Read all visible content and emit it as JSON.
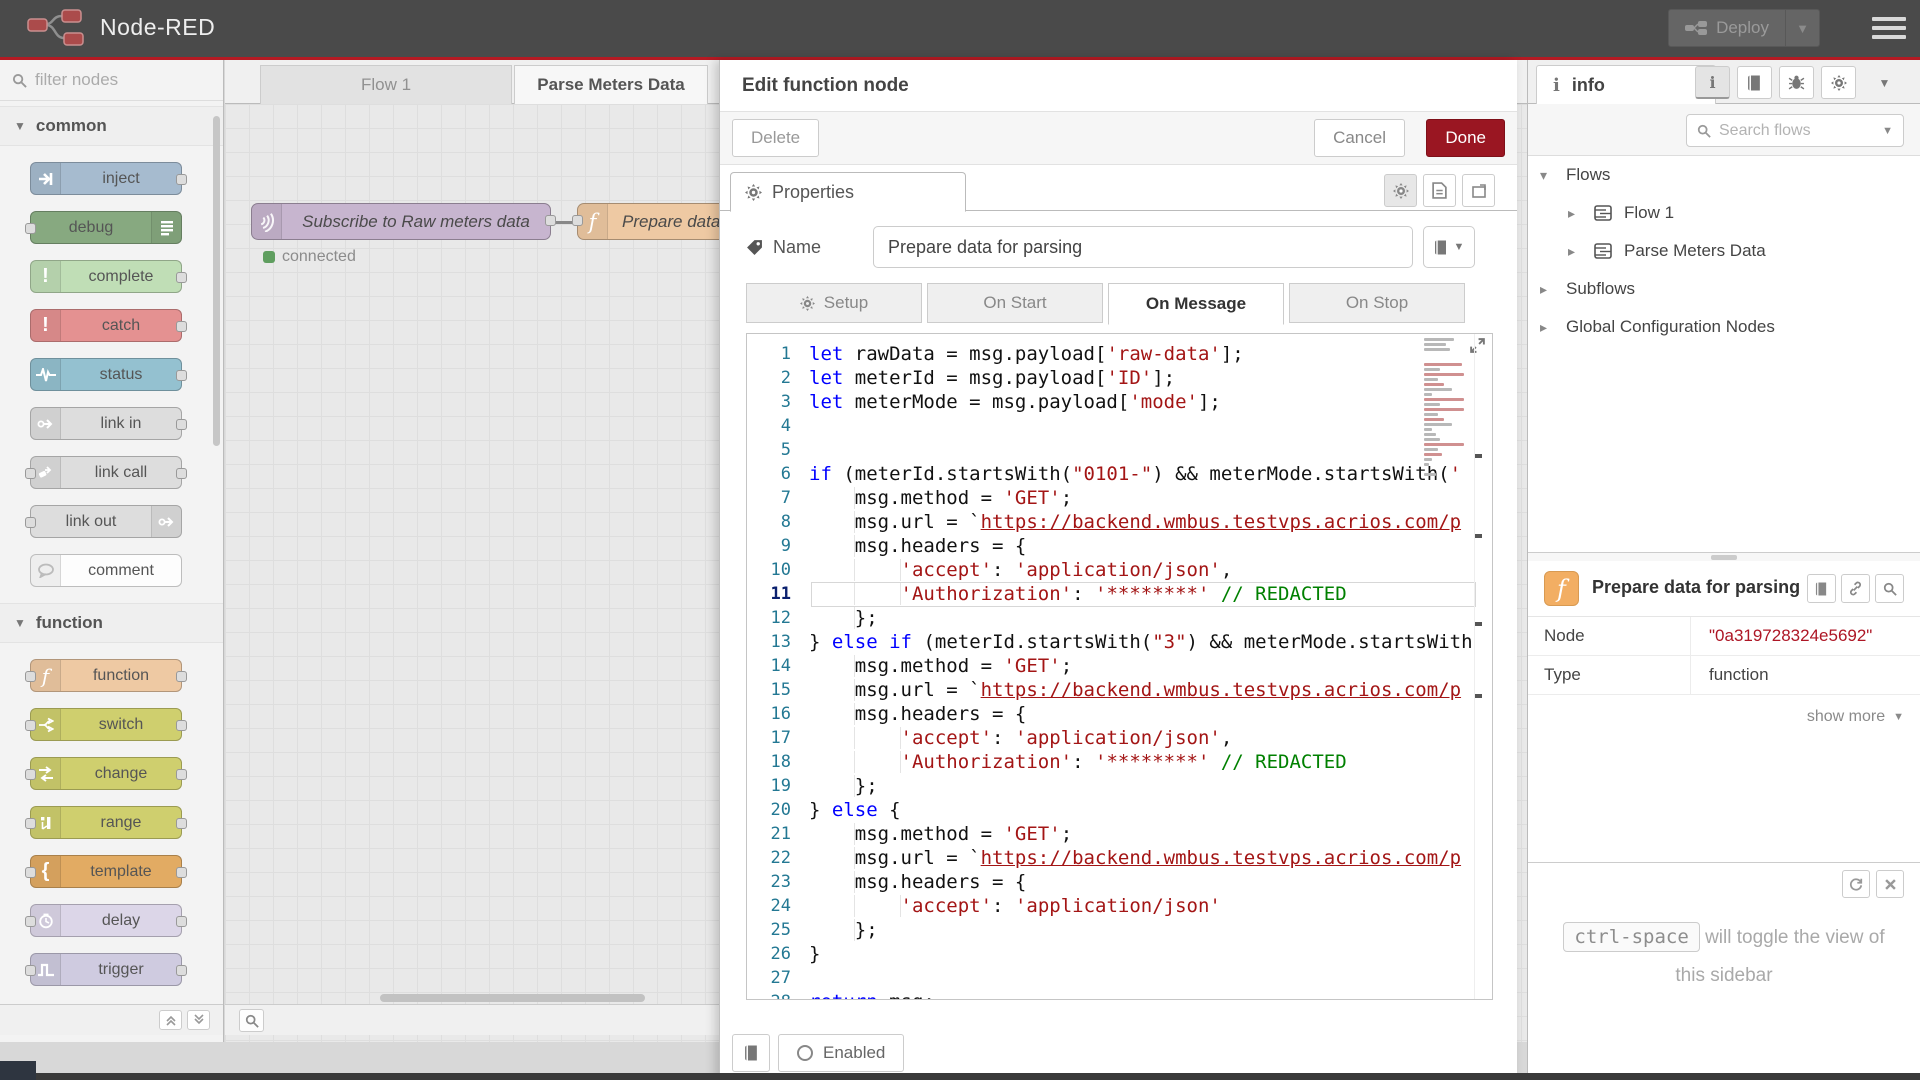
{
  "colors": {
    "accent_red": "#AD1625",
    "header_bg": "#4a4a4a",
    "status_green": "#5f9e5f",
    "node_id_red": "#AD1625"
  },
  "header": {
    "title": "Node-RED",
    "deploy_label": "Deploy"
  },
  "palette": {
    "filter_placeholder": "filter nodes",
    "categories": [
      {
        "label": "common",
        "nodes": [
          {
            "label": "inject",
            "color": "#a6bbcf",
            "icon": "inject-icon",
            "iconSide": "left",
            "ports": "out"
          },
          {
            "label": "debug",
            "color": "#87a980",
            "icon": "debug-icon",
            "iconSide": "right",
            "ports": "in"
          },
          {
            "label": "complete",
            "color": "#c0deb6",
            "icon": "exclaim-icon",
            "iconSide": "left",
            "ports": "out"
          },
          {
            "label": "catch",
            "color": "#e49191",
            "icon": "exclaim-icon",
            "iconSide": "left",
            "ports": "out"
          },
          {
            "label": "status",
            "color": "#94c1d0",
            "icon": "status-icon",
            "iconSide": "left",
            "ports": "out"
          },
          {
            "label": "link in",
            "color": "#dddddd",
            "icon": "link-in-icon",
            "iconSide": "left",
            "ports": "out"
          },
          {
            "label": "link call",
            "color": "#dddddd",
            "icon": "link-call-icon",
            "iconSide": "left",
            "ports": "both"
          },
          {
            "label": "link out",
            "color": "#dddddd",
            "icon": "link-out-icon",
            "iconSide": "right",
            "ports": "in"
          },
          {
            "label": "comment",
            "color": "#fdfdfd",
            "icon": "comment-icon",
            "iconSide": "left",
            "ports": "none"
          }
        ]
      },
      {
        "label": "function",
        "nodes": [
          {
            "label": "function",
            "color": "#eec9a3",
            "icon": "function-icon",
            "iconSide": "left",
            "ports": "both"
          },
          {
            "label": "switch",
            "color": "#cfcf6e",
            "icon": "switch-icon",
            "iconSide": "left",
            "ports": "both"
          },
          {
            "label": "change",
            "color": "#cfcf6e",
            "icon": "change-icon",
            "iconSide": "left",
            "ports": "both"
          },
          {
            "label": "range",
            "color": "#cfcf6e",
            "icon": "range-icon",
            "iconSide": "left",
            "ports": "both"
          },
          {
            "label": "template",
            "color": "#e2ab63",
            "icon": "template-icon",
            "iconSide": "left",
            "ports": "both"
          },
          {
            "label": "delay",
            "color": "#dcd6e8",
            "icon": "delay-icon",
            "iconSide": "left",
            "ports": "both"
          },
          {
            "label": "trigger",
            "color": "#cfcbe0",
            "icon": "trigger-icon",
            "iconSide": "left",
            "ports": "both"
          }
        ]
      }
    ]
  },
  "workspace": {
    "tabs": [
      {
        "label": "Flow 1",
        "active": false
      },
      {
        "label": "Parse Meters Data",
        "active": true
      }
    ],
    "mqtt_node": {
      "label": "Subscribe to Raw meters data",
      "color": "#c7b5cf",
      "icon": "broadcast-icon"
    },
    "mqtt_status": {
      "text": "connected",
      "color": "#5f9e5f"
    },
    "function_node": {
      "label": "Prepare data for parsing",
      "color": "#eec9a3",
      "icon": "function-icon"
    }
  },
  "dialog": {
    "title": "Edit function node",
    "delete_label": "Delete",
    "cancel_label": "Cancel",
    "done_label": "Done",
    "properties_tab": "Properties",
    "name_label": "Name",
    "name_value": "Prepare data for parsing",
    "tabs": [
      {
        "label": "Setup",
        "icon": "gear-icon",
        "active": false
      },
      {
        "label": "On Start",
        "active": false
      },
      {
        "label": "On Message",
        "active": true
      },
      {
        "label": "On Stop",
        "active": false
      }
    ],
    "enabled_label": "Enabled",
    "editor": {
      "active_line": 11,
      "lines": [
        "let rawData = msg.payload['raw-data'];",
        "let meterId = msg.payload['ID'];",
        "let meterMode = msg.payload['mode'];",
        "",
        "",
        "if (meterId.startsWith(\"0101-\") && meterMode.startsWith('",
        "    msg.method = 'GET';",
        "    msg.url = `https://backend.wmbus.testvps.acrios.com/p",
        "    msg.headers = {",
        "        'accept': 'application/json',",
        "        'Authorization': '********' // REDACTED",
        "    };",
        "} else if (meterId.startsWith(\"3\") && meterMode.startsWith",
        "    msg.method = 'GET';",
        "    msg.url = `https://backend.wmbus.testvps.acrios.com/p",
        "    msg.headers = {",
        "        'accept': 'application/json',",
        "        'Authorization': '********' // REDACTED",
        "    };",
        "} else {",
        "    msg.method = 'GET';",
        "    msg.url = `https://backend.wmbus.testvps.acrios.com/p",
        "    msg.headers = {",
        "        'accept': 'application/json'",
        "    };",
        "}",
        "",
        "return msg;"
      ]
    }
  },
  "sidebar": {
    "tab_label": "info",
    "search_placeholder": "Search flows",
    "tree": [
      {
        "label": "Flows",
        "level": 0,
        "chevron": "down",
        "icon": null
      },
      {
        "label": "Flow 1",
        "level": 1,
        "chevron": "right",
        "icon": "flow-icon"
      },
      {
        "label": "Parse Meters Data",
        "level": 1,
        "chevron": "right",
        "icon": "flow-icon"
      },
      {
        "label": "Subflows",
        "level": 0,
        "chevron": "right",
        "icon": null
      },
      {
        "label": "Global Configuration Nodes",
        "level": 0,
        "chevron": "right",
        "icon": null
      }
    ],
    "node_info": {
      "title": "Prepare data for parsing",
      "rows": [
        {
          "label": "Node",
          "value": "\"0a319728324e5692\"",
          "value_color": "#AD1625"
        },
        {
          "label": "Type",
          "value": "function",
          "value_color": "#444444"
        }
      ],
      "show_more_label": "show more"
    },
    "tip": {
      "key": "ctrl-space",
      "text": "will toggle the view of",
      "text2": "this sidebar"
    }
  }
}
